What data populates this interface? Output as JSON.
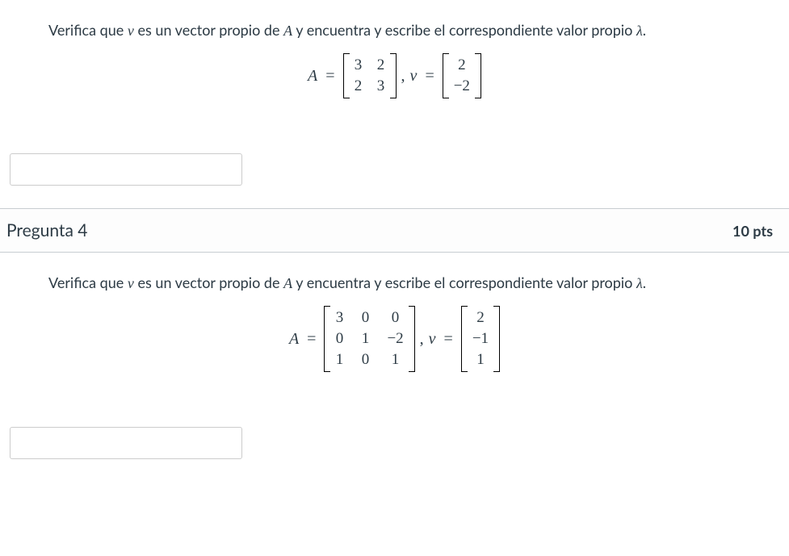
{
  "q3": {
    "prompt_pre": "Verifica que ",
    "prompt_v": "v",
    "prompt_mid": " es un vector propio de ",
    "prompt_A": "A",
    "prompt_post": " y encuentra y escribe el correspondiente valor propio ",
    "prompt_lambda": "λ",
    "prompt_dot": ".",
    "formula": {
      "A_label": "A",
      "eq": "=",
      "comma": ",",
      "v_label": "v",
      "A": {
        "r1c1": "3",
        "r1c2": "2",
        "r2c1": "2",
        "r2c2": "3"
      },
      "v": {
        "r1": "2",
        "r2": "−2"
      }
    },
    "answer_value": ""
  },
  "q4": {
    "header_title": "Pregunta 4",
    "points": "10 pts",
    "prompt_pre": "Verifica que ",
    "prompt_v": "v",
    "prompt_mid": " es un vector propio de ",
    "prompt_A": "A",
    "prompt_post": " y encuentra y escribe el correspondiente valor propio ",
    "prompt_lambda": "λ",
    "prompt_dot": ".",
    "formula": {
      "A_label": "A",
      "eq": "=",
      "comma": ",",
      "v_label": "v",
      "A": {
        "r1c1": "3",
        "r1c2": "0",
        "r1c3": "0",
        "r2c1": "0",
        "r2c2": "1",
        "r2c3": "−2",
        "r3c1": "1",
        "r3c2": "0",
        "r3c3": "1"
      },
      "v": {
        "r1": "2",
        "r2": "−1",
        "r3": "1"
      }
    },
    "answer_value": ""
  }
}
